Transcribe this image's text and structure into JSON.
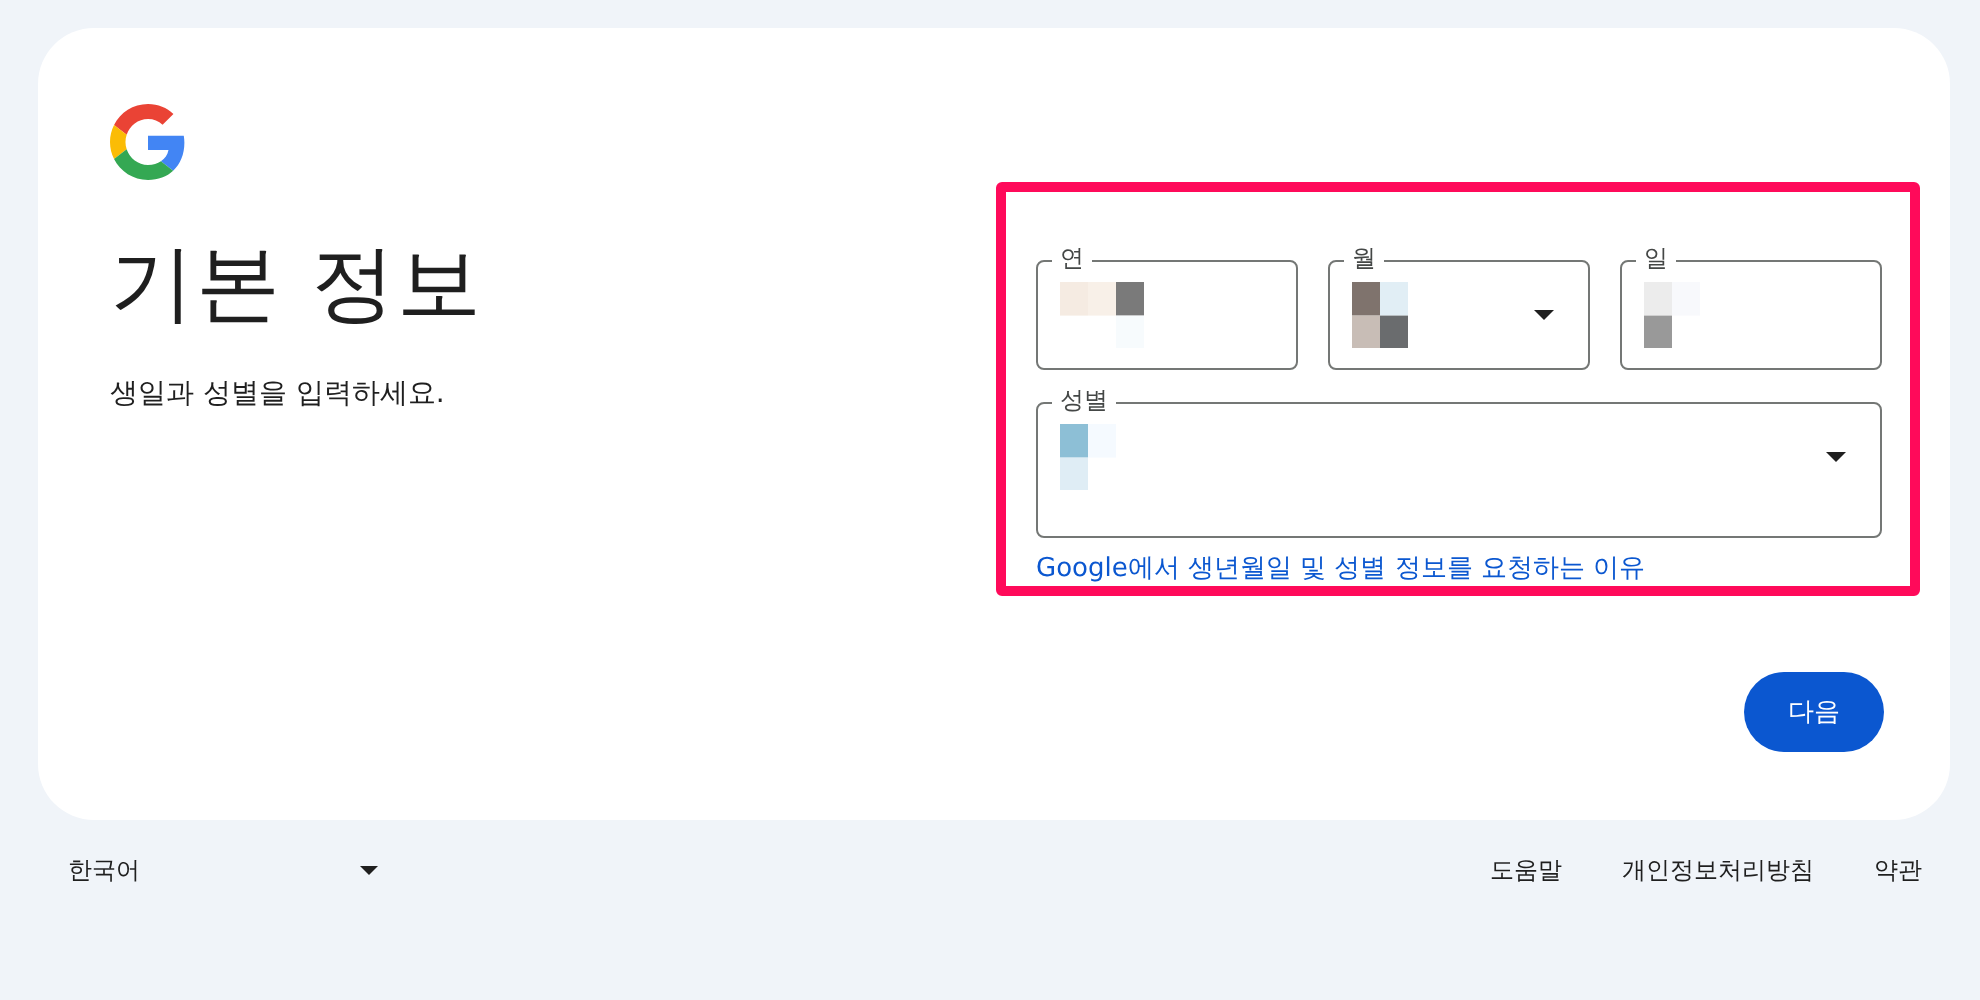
{
  "heading": {
    "title": "기본 정보",
    "subtitle": "생일과 성별을 입력하세요."
  },
  "form": {
    "highlighted": true,
    "date_fields": [
      {
        "label": "연",
        "kind": "text",
        "redacted": true
      },
      {
        "label": "월",
        "kind": "select",
        "redacted": true
      },
      {
        "label": "일",
        "kind": "text",
        "redacted": true
      }
    ],
    "gender_field": {
      "label": "성별",
      "kind": "select",
      "redacted": true
    },
    "info_link": "Google에서 생년월일 및 성별 정보를 요청하는 이유"
  },
  "next_button": "다음",
  "footer": {
    "language": "한국어",
    "links": [
      "도움말",
      "개인정보처리방침",
      "약관"
    ]
  }
}
